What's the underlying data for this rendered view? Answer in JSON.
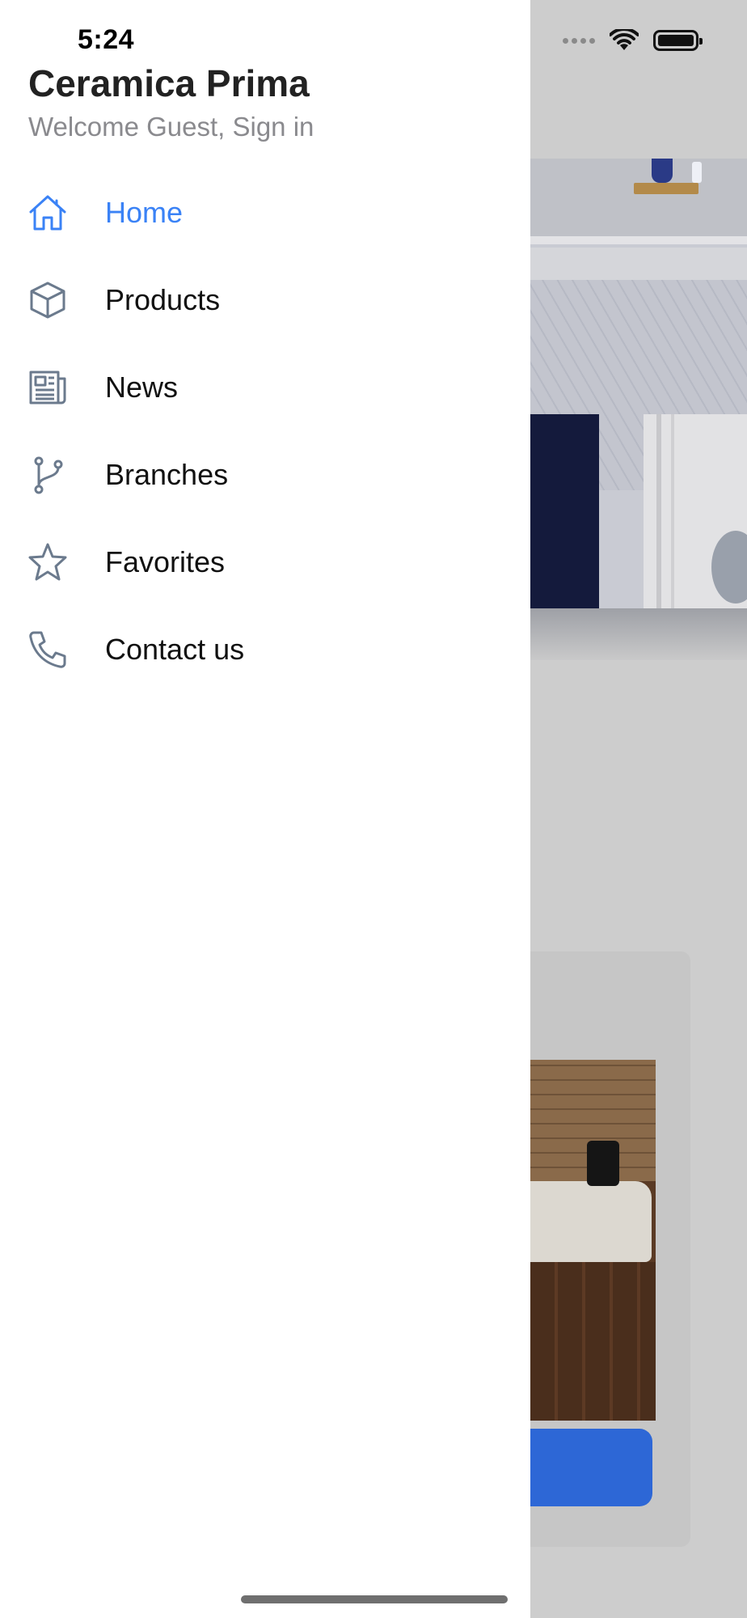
{
  "status_bar": {
    "time": "5:24"
  },
  "drawer": {
    "title": "Ceramica Prima",
    "subtitle": "Welcome Guest, Sign in",
    "items": [
      {
        "label": "Home",
        "icon": "home-icon",
        "active": true
      },
      {
        "label": "Products",
        "icon": "cube-icon",
        "active": false
      },
      {
        "label": "News",
        "icon": "newspaper-icon",
        "active": false
      },
      {
        "label": "Branches",
        "icon": "git-branch-icon",
        "active": false
      },
      {
        "label": "Favorites",
        "icon": "star-icon",
        "active": false
      },
      {
        "label": "Contact us",
        "icon": "phone-icon",
        "active": false
      }
    ]
  },
  "colors": {
    "accent": "#3a82f6",
    "icon_gray": "#6b7a8d",
    "button_blue": "#2d67d6"
  }
}
